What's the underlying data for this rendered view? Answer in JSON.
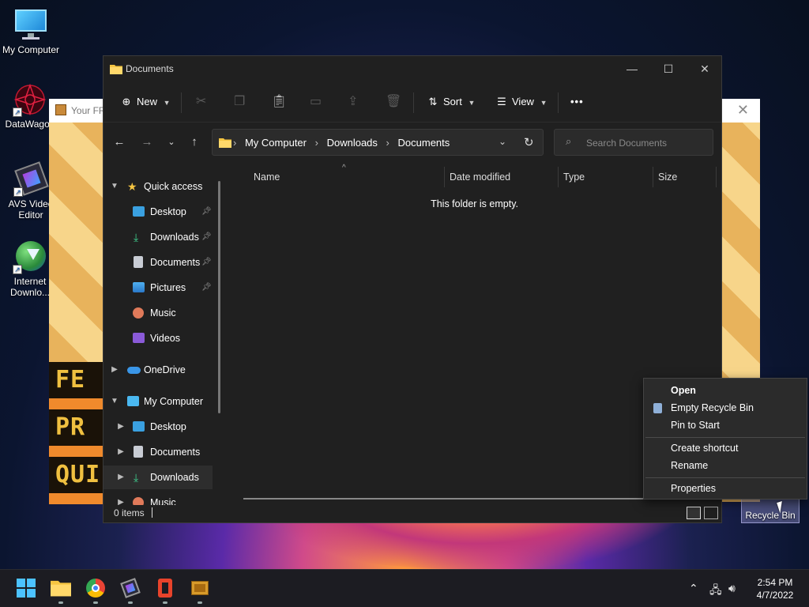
{
  "desktop": {
    "icons": [
      {
        "label": "My Computer"
      },
      {
        "label": "DataWagon"
      },
      {
        "label": "AVS Video Editor"
      },
      {
        "label": "Internet Downlo..."
      }
    ],
    "recycle_bin_label": "Recycle Bin"
  },
  "background_window": {
    "title": "Your FR",
    "words": [
      "FE",
      "PR",
      "QUI"
    ]
  },
  "explorer": {
    "title": "Documents",
    "toolbar": {
      "new_label": "New",
      "sort_label": "Sort",
      "view_label": "View",
      "more_label": "•••"
    },
    "breadcrumbs": [
      "My Computer",
      "Downloads",
      "Documents"
    ],
    "search_placeholder": "Search Documents",
    "nav": {
      "quick_access": "Quick access",
      "quick_items": [
        {
          "label": "Desktop",
          "pinned": true
        },
        {
          "label": "Downloads",
          "pinned": true
        },
        {
          "label": "Documents",
          "pinned": true
        },
        {
          "label": "Pictures",
          "pinned": true
        },
        {
          "label": "Music",
          "pinned": false
        },
        {
          "label": "Videos",
          "pinned": false
        }
      ],
      "onedrive": "OneDrive",
      "my_computer": "My Computer",
      "computer_items": [
        {
          "label": "Desktop"
        },
        {
          "label": "Documents"
        },
        {
          "label": "Downloads"
        },
        {
          "label": "Music"
        }
      ],
      "selected": "Downloads"
    },
    "columns": [
      "Name",
      "Date modified",
      "Type",
      "Size"
    ],
    "empty_message": "This folder is empty.",
    "status": "0 items"
  },
  "context_menu": {
    "items": [
      {
        "label": "Open",
        "bold": true
      },
      {
        "label": "Empty Recycle Bin",
        "icon": "recycle-bin-icon"
      },
      {
        "label": "Pin to Start"
      },
      {
        "label": "Create shortcut"
      },
      {
        "label": "Rename"
      },
      {
        "label": "Properties"
      }
    ]
  },
  "taskbar": {
    "apps": [
      "start-icon",
      "file-explorer-icon",
      "chrome-icon",
      "video-editor-icon",
      "office-icon",
      "archive-icon"
    ],
    "clock_time": "2:54 PM",
    "clock_date": "4/7/2022"
  },
  "colors": {
    "accent": "#0078d4",
    "window_bg": "#202020",
    "menu_bg": "#2b2b2b"
  }
}
